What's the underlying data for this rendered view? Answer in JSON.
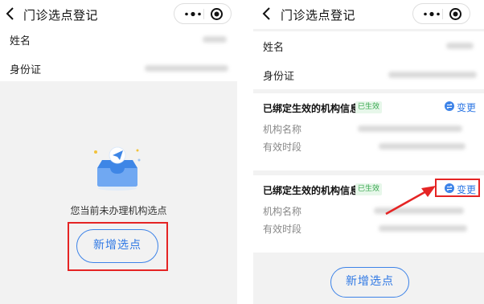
{
  "left": {
    "title": "门诊选点登记",
    "name_label": "姓名",
    "id_label": "身份证",
    "empty_text": "您当前未办理机构选点",
    "add_button": "新增选点"
  },
  "right": {
    "title": "门诊选点登记",
    "name_label": "姓名",
    "id_label": "身份证",
    "cards": [
      {
        "title": "已绑定生效的机构信息",
        "badge": "已生效",
        "action": "变更",
        "field_1": "机构名称",
        "field_2": "有效时段"
      },
      {
        "title": "已绑定生效的机构信息",
        "badge": "已生效",
        "action": "变更",
        "field_1": "机构名称",
        "field_2": "有效时段"
      }
    ],
    "add_button": "新增选点"
  },
  "icons": {
    "back": "back-chevron-icon",
    "more": "more-dots-icon",
    "close": "target-circle-icon",
    "illustration": "empty-inbox-paper-plane-icon",
    "exchange": "exchange-icon"
  },
  "colors": {
    "accent": "#2f78e4",
    "highlight": "#e52424",
    "badge": "#38a84f",
    "page_bg": "#f2f2f2"
  }
}
